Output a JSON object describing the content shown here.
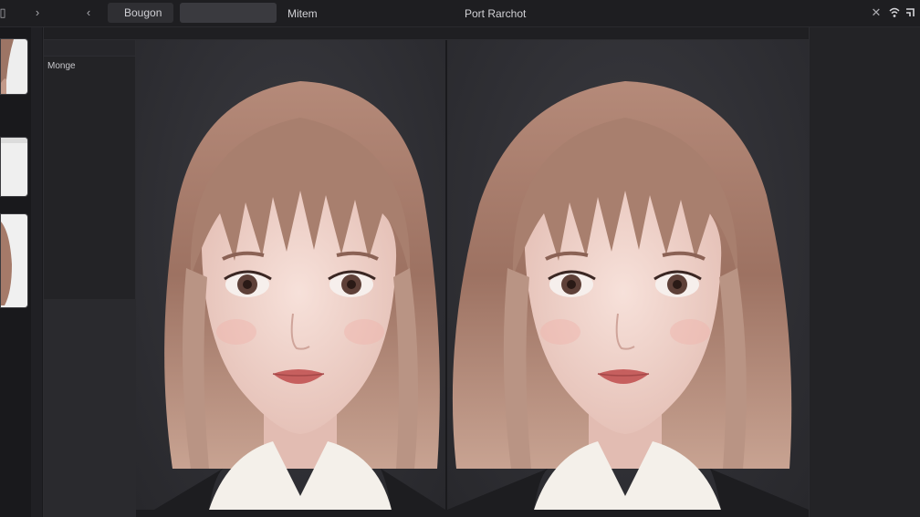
{
  "topbar": {
    "tab_1": "Bougon",
    "tab_2": "",
    "menu_text": "Mitem",
    "title": "Port Rarchot",
    "close_glyph": "✕",
    "icon_back": "chevron-left-icon",
    "icon_forward": "chevron-right-icon",
    "icon_close": "close-icon",
    "icon_wifi": "wifi-icon",
    "icon_window": "window-snap-icon"
  },
  "side_panel": {
    "label": "Monge"
  },
  "colors": {
    "background": "#1c1c1f",
    "panel": "#232326",
    "canvas": "#2f2f34",
    "hair": "#a77f6e",
    "skin": "#f2d6cf",
    "lips": "#c65f5e",
    "shirt": "#f3efea"
  },
  "canvases": [
    {
      "name": "original-portrait"
    },
    {
      "name": "edited-portrait"
    }
  ]
}
